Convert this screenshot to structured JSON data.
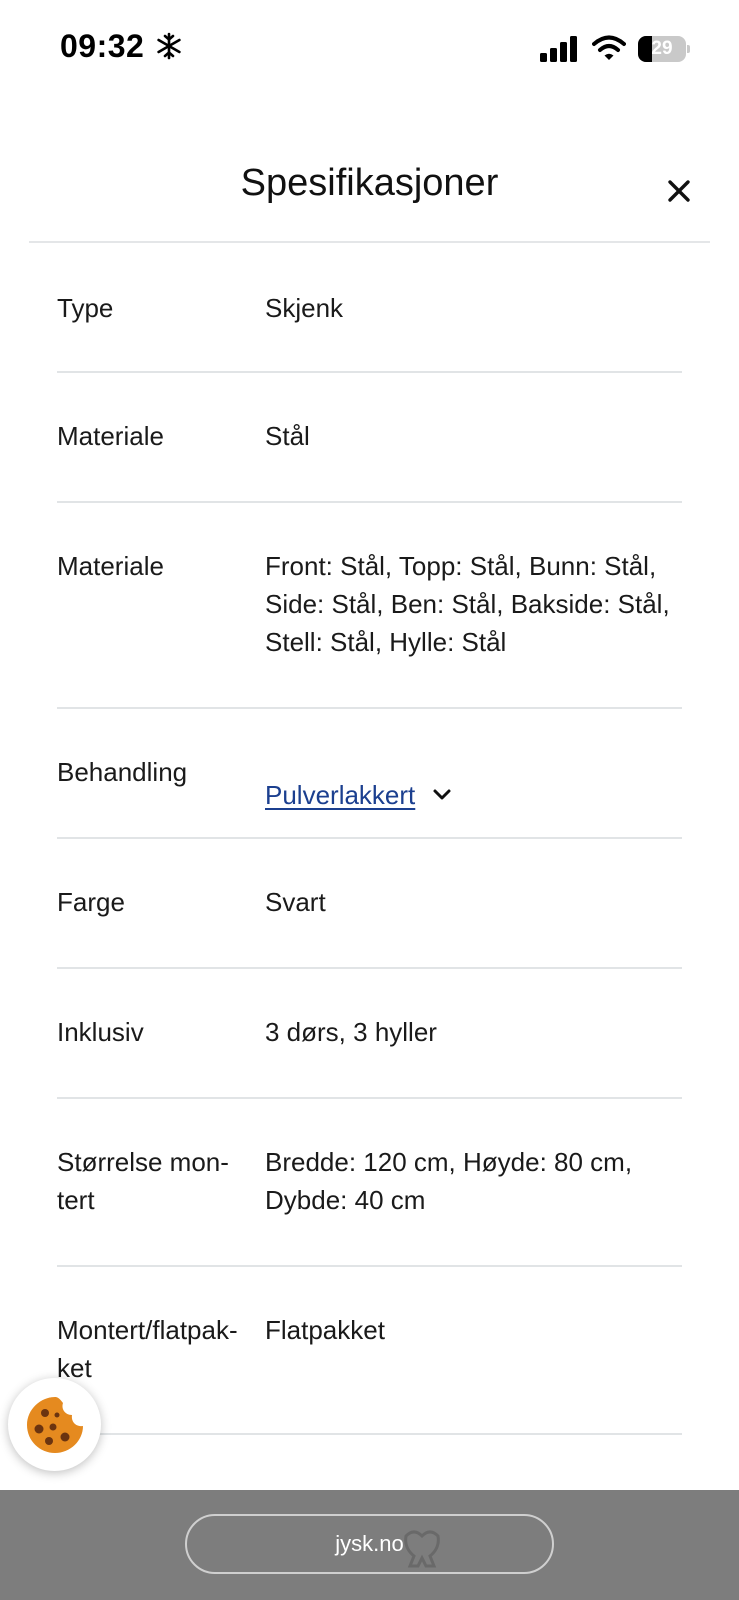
{
  "status_bar": {
    "time": "09:32",
    "battery_level": "29",
    "battery_fraction": 0.29
  },
  "header": {
    "title": "Spesifikasjoner"
  },
  "specs": [
    {
      "label": "Type",
      "value": "Skjenk"
    },
    {
      "label": "Materiale",
      "value": "Stål"
    },
    {
      "label": "Materiale",
      "value": "Front: Stål, Topp: Stål, Bunn: Stål, Side: Stål, Ben: Stål, Bakside: Stål, Stell: Stål, Hylle: Stål"
    },
    {
      "label": "Behandling",
      "value": "Pulverlakkert"
    },
    {
      "label": "Farge",
      "value": "Svart"
    },
    {
      "label": "Inklusiv",
      "value": "3 dørs, 3 hyller"
    },
    {
      "label": "Størrelse mon-tert",
      "value": "Bredde: 120 cm, Høyde: 80 cm, Dybde: 40 cm"
    },
    {
      "label": "Montert/flatpak-ket",
      "value": "Flatpakket"
    }
  ],
  "browser": {
    "url": "jysk.no"
  },
  "colors": {
    "link": "#1b3f8f",
    "divider": "#e1e4e6",
    "browser_bar": "#7d7d7d",
    "cookie": "#e58a1f"
  },
  "icons": {
    "close": "close-icon",
    "expand": "chevron-down-icon",
    "cookie": "cookie-icon",
    "signal": "cellular-signal-icon",
    "wifi": "wifi-icon",
    "battery": "battery-icon",
    "snow": "snowflake-icon"
  }
}
